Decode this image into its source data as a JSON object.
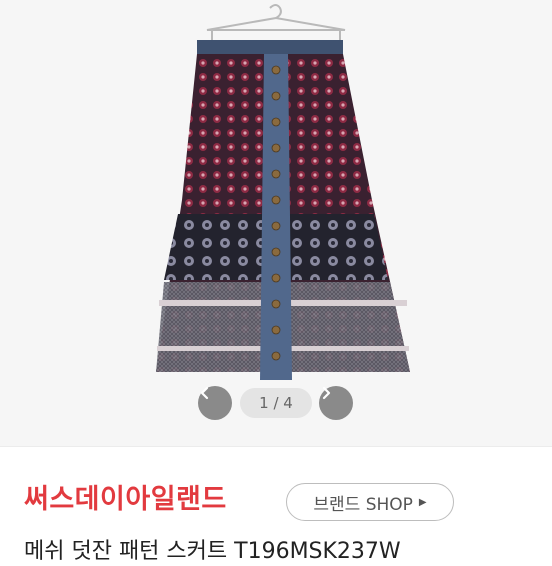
{
  "gallery": {
    "counter_text": "1 / 4",
    "prev_icon": "chevron-left-icon",
    "next_icon": "chevron-right-icon"
  },
  "brand": {
    "name": "써스데이아일랜드",
    "shop_label": "브랜드 SHOP",
    "shop_arrow_icon": "caret-right-icon",
    "name_color": "#e23a3f"
  },
  "product": {
    "title": "메쉬 덧잔 패턴 스커트 T196MSK237W"
  }
}
